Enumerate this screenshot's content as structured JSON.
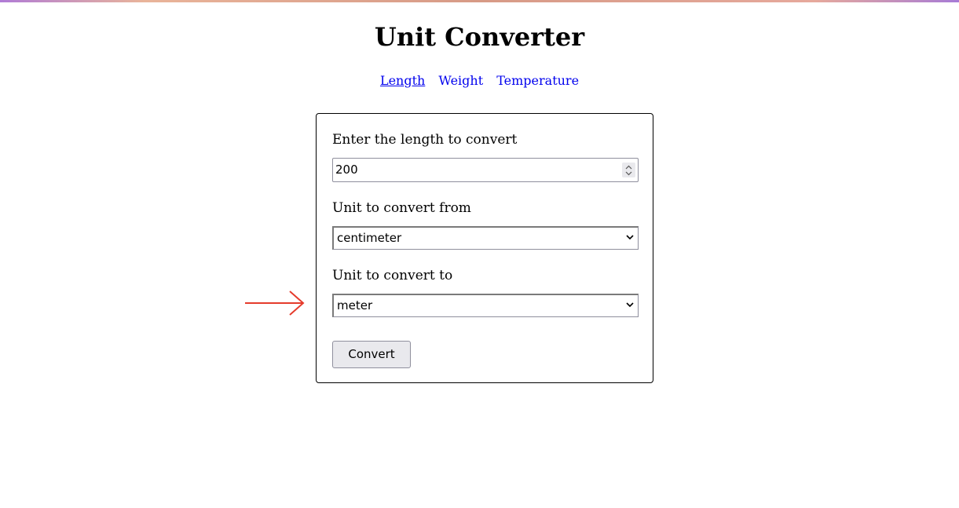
{
  "page": {
    "title": "Unit Converter"
  },
  "nav": {
    "items": [
      {
        "label": "Length",
        "active": true
      },
      {
        "label": "Weight",
        "active": false
      },
      {
        "label": "Temperature",
        "active": false
      }
    ]
  },
  "form": {
    "length_label": "Enter the length to convert",
    "length_value": "200",
    "from_label": "Unit to convert from",
    "from_value": "centimeter",
    "to_label": "Unit to convert to",
    "to_value": "meter",
    "convert_label": "Convert"
  },
  "annotation": {
    "icon": "right-arrow-icon",
    "color": "#e53b2c"
  },
  "colors": {
    "link": "#0000ee",
    "button_bg": "#e9e9ed"
  }
}
